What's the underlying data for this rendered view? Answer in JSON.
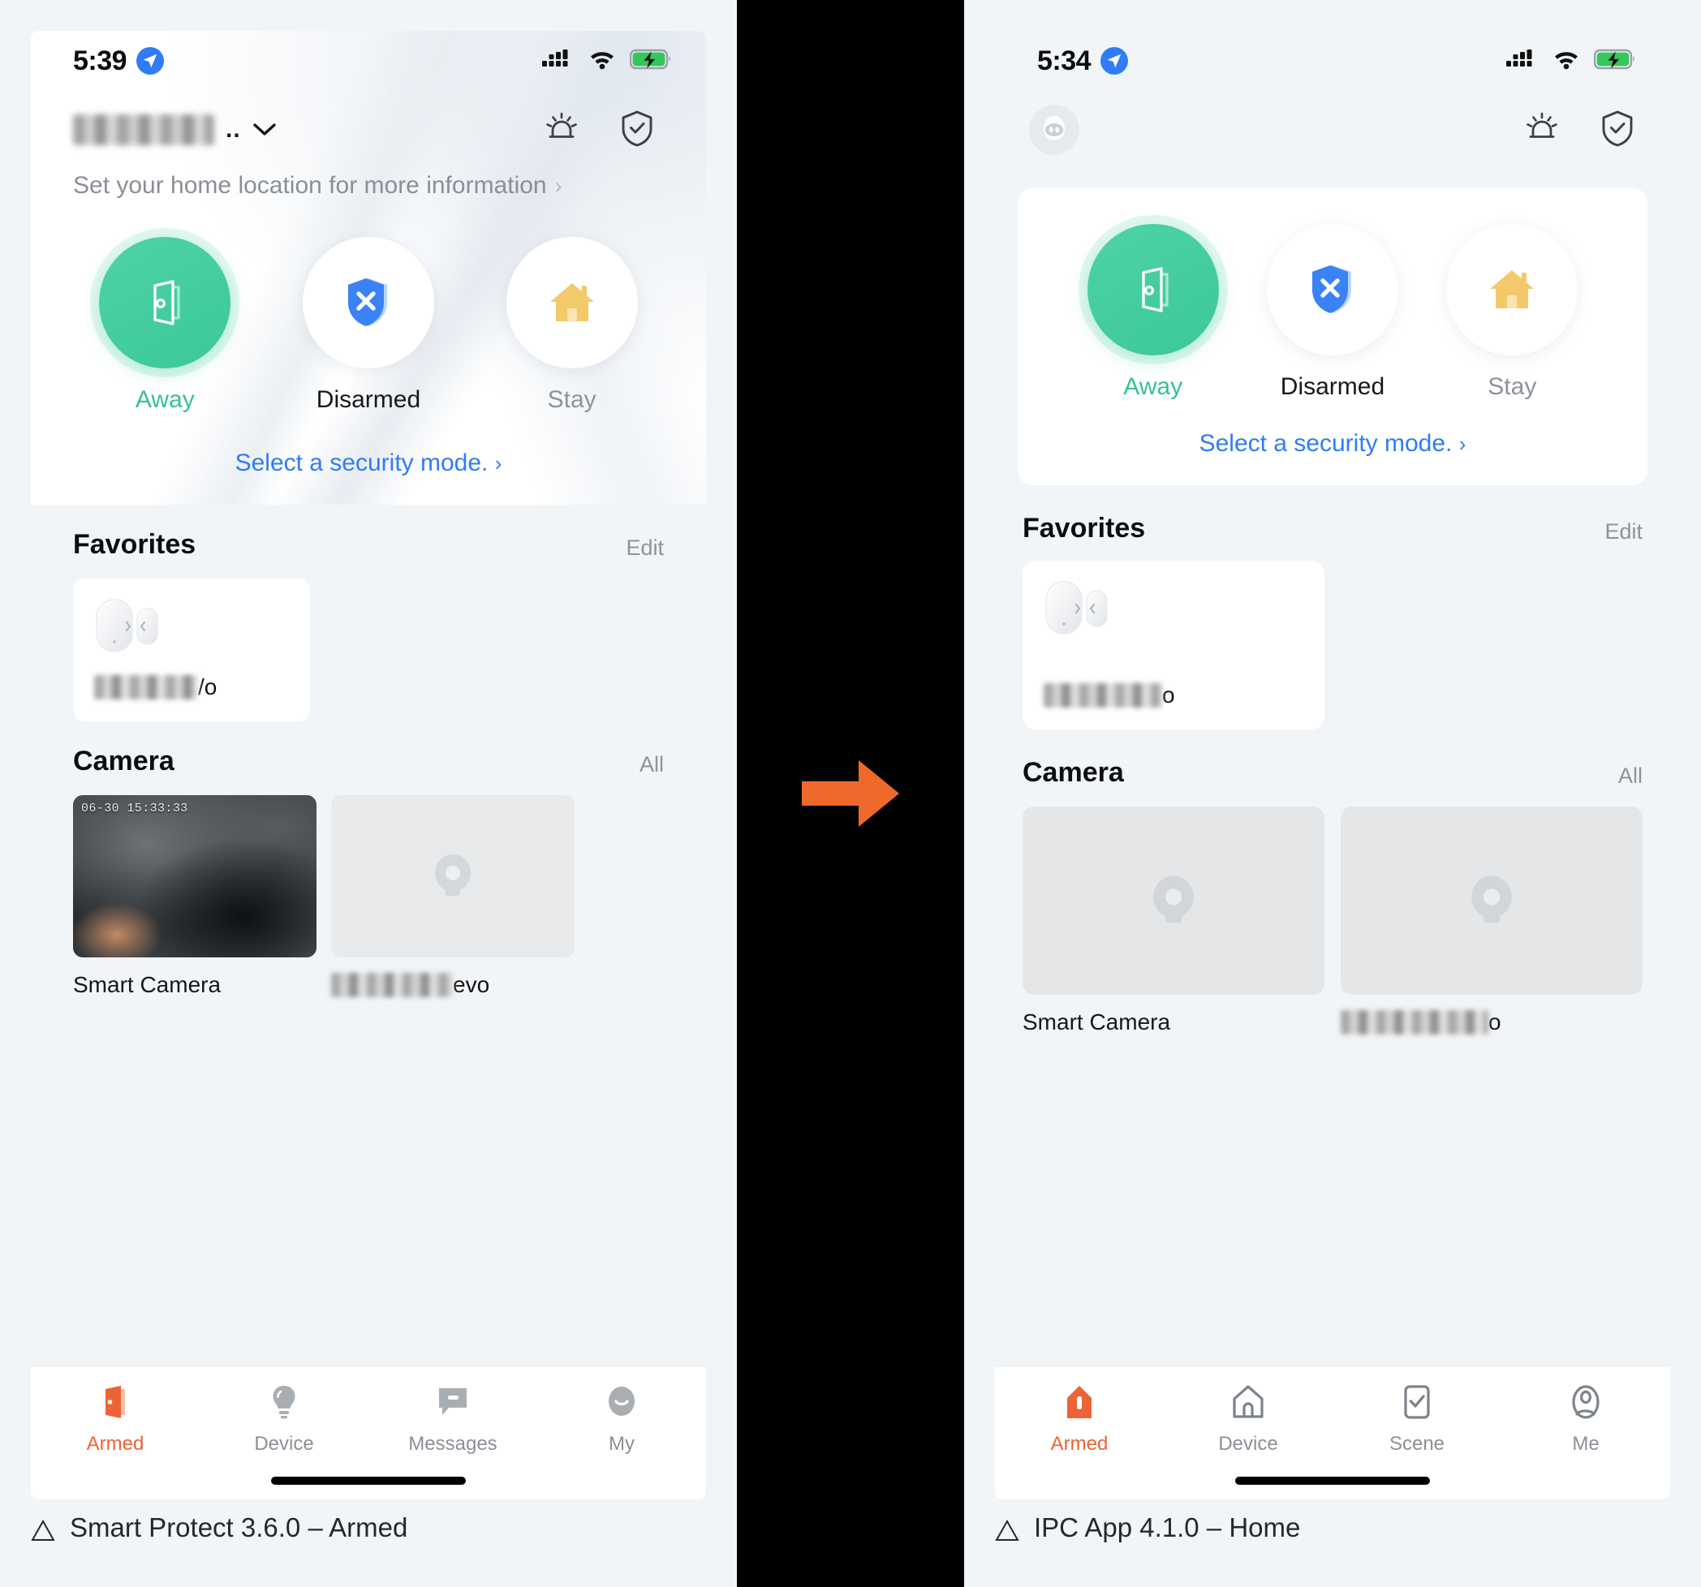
{
  "left_phone": {
    "status_bar": {
      "time": "5:39",
      "location_icon": "location-arrow-icon",
      "signal_icon": "cellular-signal-icon",
      "wifi_icon": "wifi-icon",
      "battery_icon": "battery-charging-icon"
    },
    "header": {
      "home_name": "",
      "home_name_suffix": "..",
      "chevron": "chevron-down-icon",
      "alarm_icon": "siren-icon",
      "shield_icon": "shield-check-icon"
    },
    "location_prompt": {
      "text": "Set your home location for more information",
      "chevron": "›"
    },
    "modes": [
      {
        "label": "Away",
        "icon": "open-door-icon",
        "state": "active"
      },
      {
        "label": "Disarmed",
        "icon": "shield-x-icon",
        "state": "inactive"
      },
      {
        "label": "Stay",
        "icon": "house-icon",
        "state": "inactive"
      }
    ],
    "select_mode_link": {
      "text": "Select a security mode.",
      "chevron": "›"
    },
    "favorites": {
      "title": "Favorites",
      "action": "Edit",
      "items": [
        {
          "icon": "door-window-sensor-icon",
          "name_visible_tail": "/o",
          "name_redacted": true
        }
      ]
    },
    "camera": {
      "title": "Camera",
      "action": "All",
      "items": [
        {
          "label": "Smart Camera",
          "timestamp": "06-30 15:33:33",
          "has_preview": true,
          "name_redacted": false
        },
        {
          "label": "",
          "name_visible_tail": "evo",
          "has_preview": false,
          "name_redacted": true,
          "placeholder_icon": "camera-icon"
        }
      ]
    },
    "tabbar": [
      {
        "label": "Armed",
        "icon": "open-door-icon",
        "active": true
      },
      {
        "label": "Device",
        "icon": "lightbulb-icon",
        "active": false
      },
      {
        "label": "Messages",
        "icon": "chat-bubble-icon",
        "active": false
      },
      {
        "label": "My",
        "icon": "user-avatar-icon",
        "active": false
      }
    ]
  },
  "right_phone": {
    "status_bar": {
      "time": "5:34",
      "location_icon": "location-arrow-icon",
      "signal_icon": "cellular-signal-icon",
      "wifi_icon": "wifi-icon",
      "battery_icon": "battery-charging-icon"
    },
    "header": {
      "avatar_icon": "user-avatar-icon",
      "alarm_icon": "siren-icon",
      "shield_icon": "shield-check-icon"
    },
    "modes": [
      {
        "label": "Away",
        "icon": "open-door-icon",
        "state": "active"
      },
      {
        "label": "Disarmed",
        "icon": "shield-x-icon",
        "state": "inactive"
      },
      {
        "label": "Stay",
        "icon": "house-icon",
        "state": "inactive"
      }
    ],
    "select_mode_link": {
      "text": "Select a security mode.",
      "chevron": "›"
    },
    "favorites": {
      "title": "Favorites",
      "action": "Edit",
      "items": [
        {
          "icon": "door-window-sensor-icon",
          "name_visible_tail": "o",
          "name_redacted": true
        }
      ]
    },
    "camera": {
      "title": "Camera",
      "action": "All",
      "items": [
        {
          "label": "Smart Camera",
          "has_preview": false,
          "name_redacted": false,
          "placeholder_icon": "camera-icon"
        },
        {
          "label": "",
          "name_visible_tail": "o",
          "has_preview": false,
          "name_redacted": true,
          "placeholder_icon": "camera-icon"
        }
      ]
    },
    "tabbar": [
      {
        "label": "Armed",
        "icon": "house-filled-icon",
        "active": true
      },
      {
        "label": "Device",
        "icon": "house-outline-icon",
        "active": false
      },
      {
        "label": "Scene",
        "icon": "checkbox-check-icon",
        "active": false
      },
      {
        "label": "Me",
        "icon": "person-pin-icon",
        "active": false
      }
    ]
  },
  "captions": {
    "left": "Smart Protect 3.6.0 – Armed",
    "right": "IPC App 4.1.0 – Home",
    "marker_icon": "triangle-outline-icon"
  },
  "transition": {
    "arrow_icon": "right-arrow-icon"
  },
  "colors": {
    "accent_orange": "#ec6335",
    "mode_active_green": "#3cc79b",
    "link_blue": "#2f7cf6",
    "shield_blue": "#3b82f6",
    "house_yellow": "#f5cd72",
    "page_bg": "#f2f5f8"
  }
}
